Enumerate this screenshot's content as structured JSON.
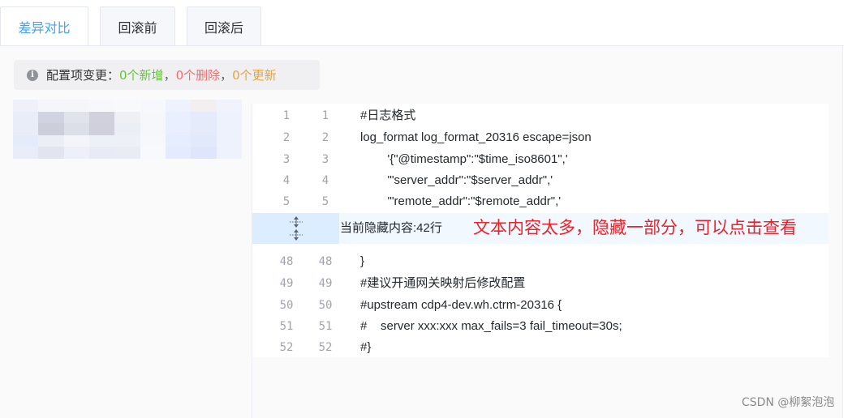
{
  "tabs": [
    {
      "label": "差异对比",
      "active": true
    },
    {
      "label": "回滚前",
      "active": false
    },
    {
      "label": "回滚后",
      "active": false
    }
  ],
  "alert": {
    "icon": "info-icon",
    "prefix": "配置项变更：",
    "added": "0个新增",
    "sep1": "，",
    "deleted": "0个删除",
    "sep2": "，",
    "updated": "0个更新",
    "colors": {
      "added": "#67c23a",
      "deleted": "#f56c6c",
      "updated": "#e6a23c"
    }
  },
  "diff": {
    "top_lines": [
      {
        "left": "1",
        "right": "1",
        "code": "#日志格式"
      },
      {
        "left": "2",
        "right": "2",
        "code": "log_format log_format_20316 escape=json"
      },
      {
        "left": "3",
        "right": "3",
        "code": "        '{\"@timestamp\":\"$time_iso8601\",'"
      },
      {
        "left": "4",
        "right": "4",
        "code": "        '\"server_addr\":\"$server_addr\",'"
      },
      {
        "left": "5",
        "right": "5",
        "code": "        '\"remote_addr\":\"$remote_addr\",'"
      }
    ],
    "hidden_label": "当前隐藏内容:42行",
    "bottom_lines": [
      {
        "left": "48",
        "right": "48",
        "code": "}"
      },
      {
        "left": "49",
        "right": "49",
        "code": "#建议开通网关映射后修改配置"
      },
      {
        "left": "50",
        "right": "50",
        "code": "#upstream cdp4-dev.wh.ctrm-20316 {"
      },
      {
        "left": "51",
        "right": "51",
        "code": "#    server xxx:xxx max_fails=3 fail_timeout=30s;"
      },
      {
        "left": "52",
        "right": "52",
        "code": "#}"
      }
    ]
  },
  "annotation": "文本内容太多，隐藏一部分，可以点击查看",
  "watermark": "CSDN @柳絮泡泡"
}
